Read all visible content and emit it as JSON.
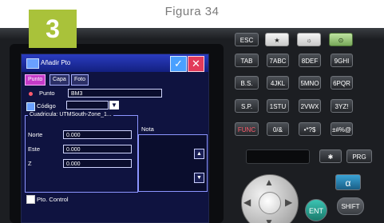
{
  "figure": {
    "caption": "Figura 34",
    "badge": "3"
  },
  "screen": {
    "title": "Añadir Pto",
    "ok_icon": "check-icon",
    "cancel_icon": "close-icon",
    "tabs": [
      {
        "label": "Punto",
        "active": true
      },
      {
        "label": "Capa",
        "active": false
      },
      {
        "label": "Foto",
        "active": false
      }
    ],
    "punto": {
      "label": "Punto",
      "value": "BM3"
    },
    "codigo": {
      "label": "Código",
      "value": ""
    },
    "grid": {
      "title": "Cuadricula: UTMSouth-Zone_1...",
      "fields": [
        {
          "label": "Norte",
          "value": "0.000"
        },
        {
          "label": "Este",
          "value": "0.000"
        },
        {
          "label": "Z",
          "value": "0.000"
        }
      ]
    },
    "nota": {
      "label": "Nota",
      "value": ""
    },
    "pto_control": {
      "label": "Pto. Control",
      "checked": false
    }
  },
  "keypad": {
    "top_row": [
      "ESC",
      "★",
      "☼",
      "⊙"
    ],
    "row1": [
      "TAB",
      "7ABC",
      "8DEF",
      "9GHI"
    ],
    "row2": [
      "B.S.",
      "4JKL",
      "5MNO",
      "6PQR"
    ],
    "row3": [
      "S.P.",
      "1STU",
      "2VWX",
      "3YZ!"
    ],
    "row4": [
      "FUNC",
      "0/&",
      "•*?$",
      "±#%@"
    ],
    "prg": "PRG",
    "alpha": "α",
    "ent": "ENT",
    "shift": "SHIFT",
    "colors": {
      "func": "#ff5a6b",
      "alpha": "#2a8cc0",
      "ent": "#2aa595",
      "power": "#78a85a"
    }
  }
}
